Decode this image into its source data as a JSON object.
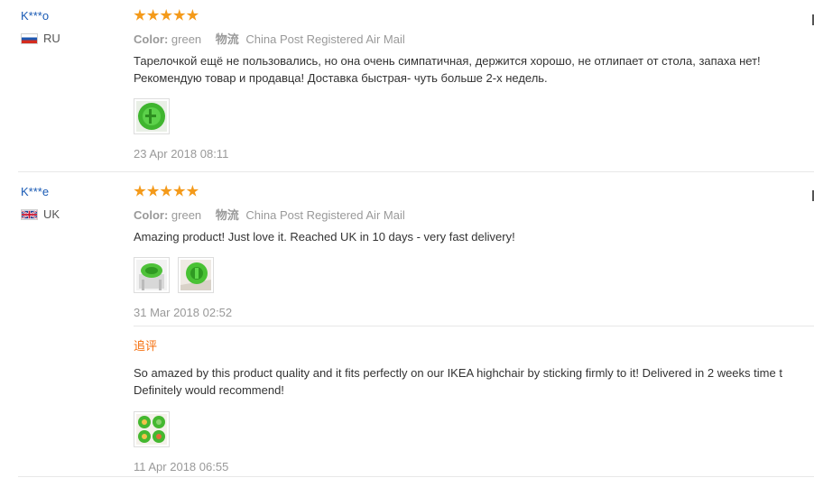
{
  "reviews": [
    {
      "username": "K***o",
      "country": "RU",
      "rating": 5,
      "color_label": "Color:",
      "color_value": "green",
      "shipping_label": "物流",
      "shipping_value": "China Post Registered Air Mail",
      "text_line1": "Тарелочкой ещё не пользовались, но она очень симпатичная, держится хорошо, не отлипает от стола, запаха нет!",
      "text_line2": "Рекомендую товар и продавца! Доставка быстрая- чуть больше 2-х недель.",
      "date": "23 Apr 2018 08:11"
    },
    {
      "username": "K***e",
      "country": "UK",
      "rating": 5,
      "color_label": "Color:",
      "color_value": "green",
      "shipping_label": "物流",
      "shipping_value": "China Post Registered Air Mail",
      "text_line1": "Amazing product! Just love it. Reached UK in 10 days - very fast delivery!",
      "date": "31 Mar 2018 02:52",
      "followup": {
        "label": "追评",
        "text_line1": "So amazed by this product quality and it fits perfectly on our IKEA highchair by sticking firmly to it! Delivered in 2 weeks time t",
        "text_line2": "Definitely would recommend!",
        "date": "11 Apr 2018 06:55"
      }
    }
  ],
  "colors": {
    "username": "#1a5bb5",
    "star": "#f49a1a",
    "followup": "#f56e0c",
    "muted": "#999999"
  },
  "icons": [
    "flag-ru-icon",
    "flag-uk-icon",
    "star-icon"
  ]
}
